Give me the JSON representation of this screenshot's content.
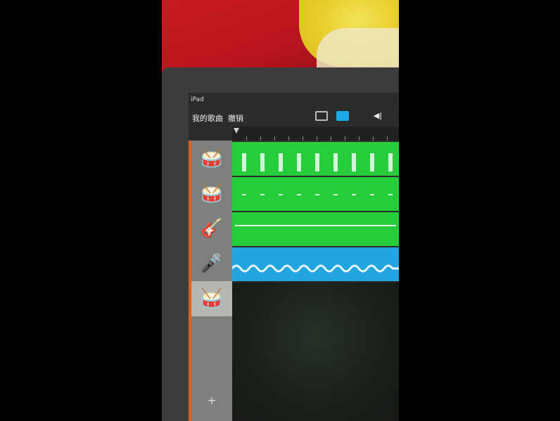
{
  "status": {
    "carrier": "iPad"
  },
  "toolbar": {
    "songs_label": "我的歌曲",
    "undo_label": "撤销",
    "mixer_icon": "mixer-icon"
  },
  "tracks": [
    {
      "name": "drums",
      "icon": "🥁",
      "color": "#25cd3a"
    },
    {
      "name": "drums",
      "icon": "🥁",
      "color": "#25cd3a"
    },
    {
      "name": "guitar",
      "icon": "🎸",
      "color": "#25cd3a"
    },
    {
      "name": "microphone",
      "icon": "🎤",
      "color": "#23a6e0"
    },
    {
      "name": "drums-selected",
      "icon": "🥁",
      "color": "#b4b7b2"
    }
  ],
  "add_track": "+",
  "colors": {
    "green_region": "#25cd3a",
    "blue_region": "#23a6e0",
    "sidebar": "#7d807c",
    "accent": "#e06020"
  }
}
